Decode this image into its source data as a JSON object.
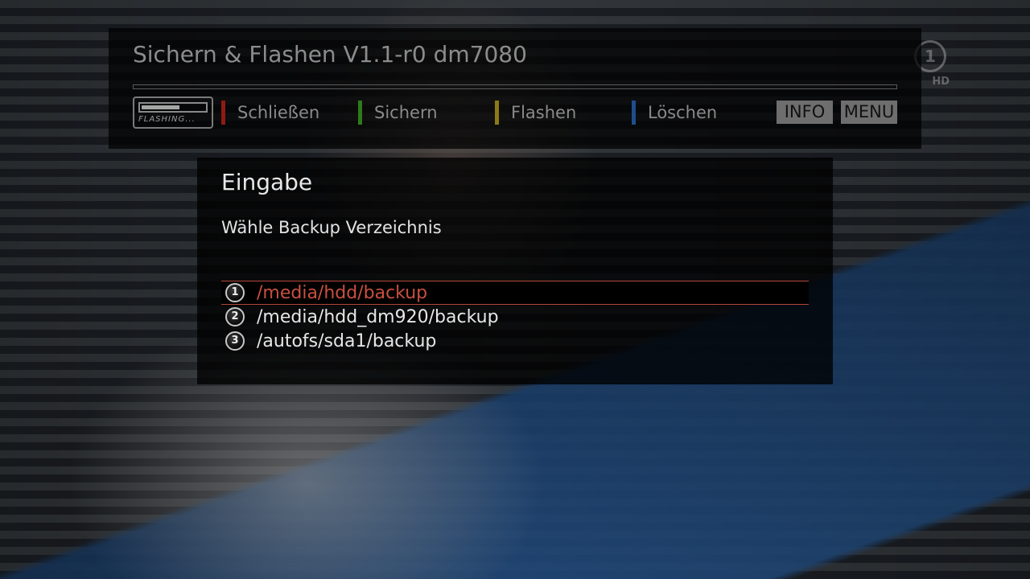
{
  "header": {
    "title": "Sichern & Flashen V1.1-r0 dm7080",
    "flash_icon_text": "FLASHING...",
    "flash_icon_progress": 0.6,
    "color_keys": [
      {
        "label": "Schließen",
        "color": "#8e1a12"
      },
      {
        "label": "Sichern",
        "color": "#2e7a1c"
      },
      {
        "label": "Flashen",
        "color": "#8c7a14"
      },
      {
        "label": "Löschen",
        "color": "#1c4f8c"
      }
    ],
    "info_label": "INFO",
    "menu_label": "MENU"
  },
  "channel_logo": {
    "mark": "1",
    "text": "HD"
  },
  "dialog": {
    "title": "Eingabe",
    "prompt": "Wähle Backup Verzeichnis",
    "items": [
      {
        "number": "1",
        "path": "/media/hdd/backup",
        "selected": true
      },
      {
        "number": "2",
        "path": "/media/hdd_dm920/backup",
        "selected": false
      },
      {
        "number": "3",
        "path": "/autofs/sda1/backup",
        "selected": false
      }
    ],
    "selection_color": "#c8503f"
  }
}
